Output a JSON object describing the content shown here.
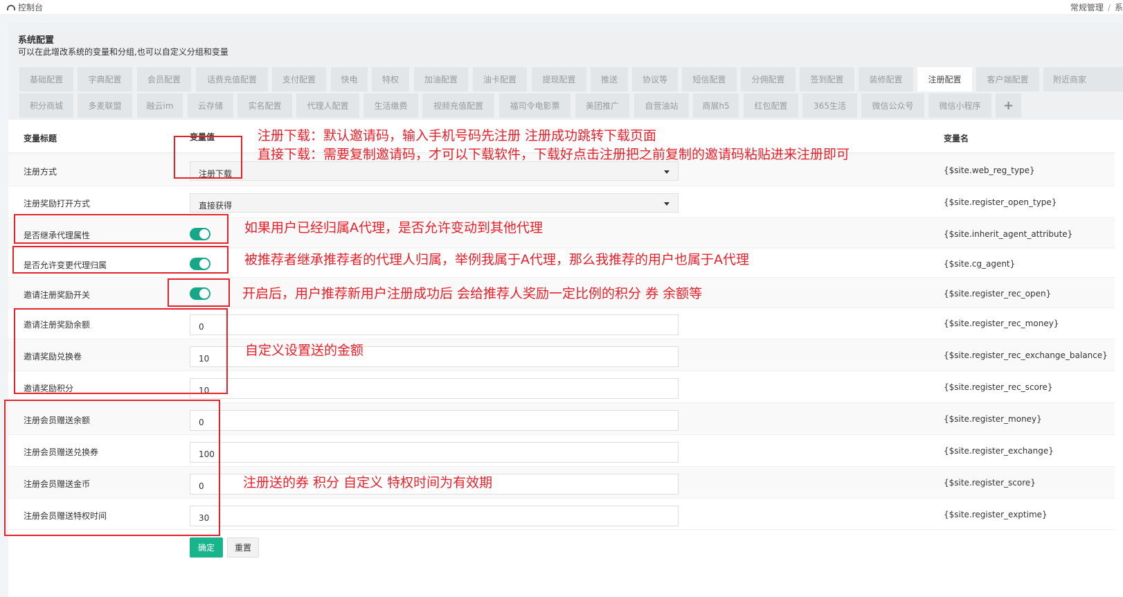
{
  "header": {
    "console_title": "控制台",
    "breadcrumb": [
      "常规管理",
      "系"
    ]
  },
  "page": {
    "title": "系统配置",
    "description": "可以在此增改系统的变量和分组,也可以自定义分组和变量"
  },
  "tabs_row1": [
    "基础配置",
    "字典配置",
    "会员配置",
    "话费充值配置",
    "支付配置",
    "快电",
    "特权",
    "加油配置",
    "油卡配置",
    "提现配置",
    "推送",
    "协议等",
    "短信配置",
    "分佣配置",
    "签到配置",
    "装修配置",
    "注册配置",
    "客户端配置",
    "附近商家"
  ],
  "tabs_row2": [
    "积分商城",
    "多麦联盟",
    "融云im",
    "云存储",
    "实名配置",
    "代理人配置",
    "生活缴费",
    "视频充值配置",
    "福司令电影票",
    "美团推广",
    "自营油站",
    "商展h5",
    "红包配置",
    "365生活",
    "微信公众号",
    "微信小程序",
    "+"
  ],
  "active_tab": "注册配置",
  "table": {
    "headers": {
      "title": "变量标题",
      "value": "变量值",
      "name": "变量名"
    },
    "rows": [
      {
        "label": "注册方式",
        "type": "select",
        "value": "注册下载",
        "var": "{$site.web_reg_type}"
      },
      {
        "label": "注册奖励打开方式",
        "type": "select",
        "value": "直接获得",
        "var": "{$site.register_open_type}"
      },
      {
        "label": "是否继承代理属性",
        "type": "switch",
        "value": "on",
        "var": "{$site.inherit_agent_attribute}"
      },
      {
        "label": "是否允许变更代理归属",
        "type": "switch",
        "value": "on",
        "var": "{$site.cg_agent}"
      },
      {
        "label": "邀请注册奖励开关",
        "type": "switch",
        "value": "on",
        "var": "{$site.register_rec_open}"
      },
      {
        "label": "邀请注册奖励余额",
        "type": "input",
        "value": "0",
        "var": "{$site.register_rec_money}"
      },
      {
        "label": "邀请奖励兑换卷",
        "type": "input",
        "value": "10",
        "var": "{$site.register_rec_exchange_balance}"
      },
      {
        "label": "邀请奖励积分",
        "type": "input",
        "value": "10",
        "var": "{$site.register_rec_score}"
      },
      {
        "label": "注册会员赠送余额",
        "type": "input",
        "value": "0",
        "var": "{$site.register_money}"
      },
      {
        "label": "注册会员赠送兑换券",
        "type": "input",
        "value": "100",
        "var": "{$site.register_exchange}"
      },
      {
        "label": "注册会员赠送金币",
        "type": "input",
        "value": "0",
        "var": "{$site.register_score}"
      },
      {
        "label": "注册会员赠送特权时间",
        "type": "input",
        "value": "30",
        "var": "{$site.register_exptime}"
      }
    ]
  },
  "buttons": {
    "ok": "确定",
    "reset": "重置"
  },
  "annotations": {
    "reg_type_line1": "注册下载：默认邀请码，输入手机号码先注册  注册成功跳转下载页面",
    "reg_type_line2": "直接下载：需要复制邀请码，才可以下载软件，下载好点击注册把之前复制的邀请码粘贴进来注册即可",
    "inherit_agent": "如果用户已经归属A代理，是否允许变动到其他代理",
    "cg_agent": "被推荐者继承推荐者的代理人归属，举例我属于A代理，那么我推荐的用户也属于A代理",
    "rec_open": "开启后，用户推荐新用户注册成功后 会给推荐人奖励一定比例的积分  券 余额等",
    "rec_amount": "自定义设置送的金额",
    "register_gift": "注册送的券 积分 自定义  特权时间为有效期"
  },
  "colors": {
    "accent": "#18a689",
    "annotation": "#e8202a"
  }
}
